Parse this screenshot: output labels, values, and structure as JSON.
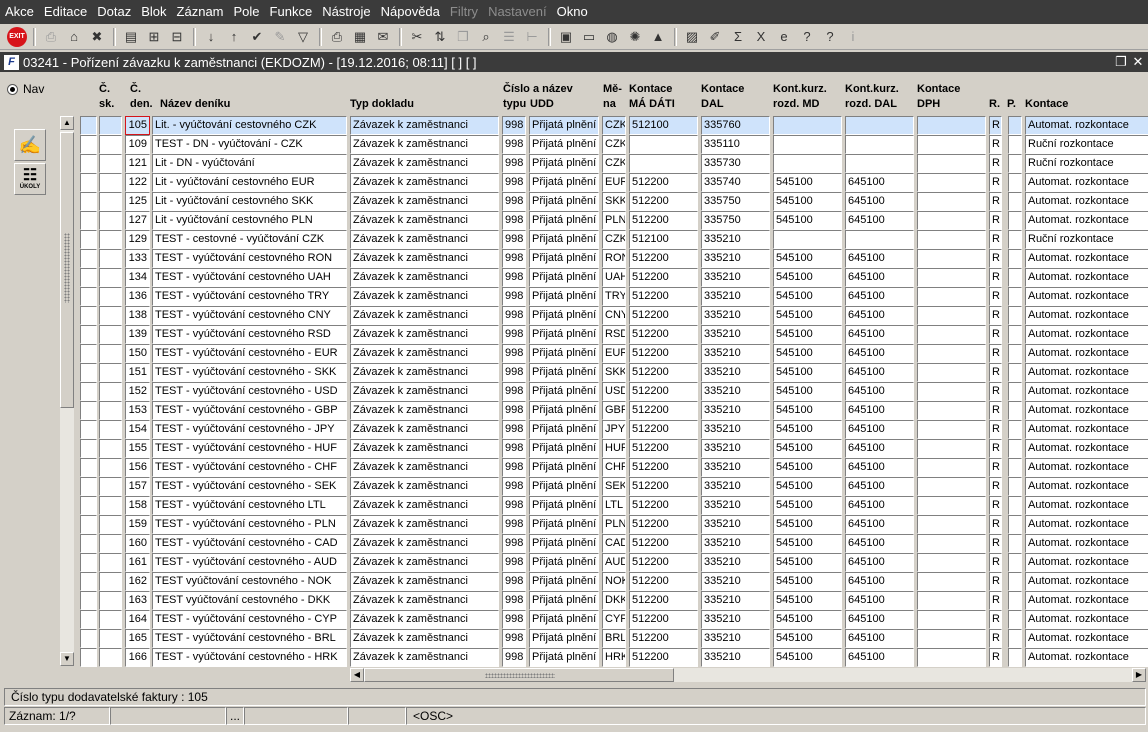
{
  "menu": [
    {
      "label": "Akce",
      "disabled": false
    },
    {
      "label": "Editace",
      "disabled": false
    },
    {
      "label": "Dotaz",
      "disabled": false
    },
    {
      "label": "Blok",
      "disabled": false
    },
    {
      "label": "Záznam",
      "disabled": false
    },
    {
      "label": "Pole",
      "disabled": false
    },
    {
      "label": "Funkce",
      "disabled": false
    },
    {
      "label": "Nástroje",
      "disabled": false
    },
    {
      "label": "Nápověda",
      "disabled": false
    },
    {
      "label": "Filtry",
      "disabled": true
    },
    {
      "label": "Nastavení",
      "disabled": true
    },
    {
      "label": "Okno",
      "disabled": false
    }
  ],
  "toolbar": {
    "exit_label": "EXIT",
    "groups": [
      [
        {
          "icon": "print-preview-icon",
          "glyph": "⎙",
          "disabled": true
        },
        {
          "icon": "home-icon",
          "glyph": "⌂",
          "disabled": false
        },
        {
          "icon": "delete-record-icon",
          "glyph": "✖",
          "disabled": false
        }
      ],
      [
        {
          "icon": "folder-icon",
          "glyph": "▤",
          "disabled": false
        },
        {
          "icon": "query-icon",
          "glyph": "⊞",
          "disabled": false
        },
        {
          "icon": "clear-icon",
          "glyph": "⊟",
          "disabled": false
        }
      ],
      [
        {
          "icon": "sort-asc-icon",
          "glyph": "↓",
          "disabled": false
        },
        {
          "icon": "sort-desc-icon",
          "glyph": "↑",
          "disabled": false
        },
        {
          "icon": "check-icon",
          "glyph": "✔",
          "disabled": false
        },
        {
          "icon": "wrench-icon",
          "glyph": "✎",
          "disabled": true
        },
        {
          "icon": "filter-icon",
          "glyph": "▽",
          "disabled": false
        }
      ],
      [
        {
          "icon": "printer-icon",
          "glyph": "⎙",
          "disabled": false
        },
        {
          "icon": "print-setup-icon",
          "glyph": "▦",
          "disabled": false
        },
        {
          "icon": "mail-icon",
          "glyph": "✉",
          "disabled": false
        }
      ],
      [
        {
          "icon": "cut-icon",
          "glyph": "✂",
          "disabled": false
        },
        {
          "icon": "paste-icon",
          "glyph": "⇅",
          "disabled": false
        },
        {
          "icon": "copy-icon",
          "glyph": "❐",
          "disabled": true
        },
        {
          "icon": "find-icon",
          "glyph": "⌕",
          "disabled": false
        },
        {
          "icon": "list-icon",
          "glyph": "☰",
          "disabled": true
        },
        {
          "icon": "tree-icon",
          "glyph": "⊢",
          "disabled": true
        }
      ],
      [
        {
          "icon": "calculator-icon",
          "glyph": "▣",
          "disabled": false
        },
        {
          "icon": "save-icon",
          "glyph": "▭",
          "disabled": false
        },
        {
          "icon": "globe-icon",
          "glyph": "◍",
          "disabled": false
        },
        {
          "icon": "sun-icon",
          "glyph": "✺",
          "disabled": false
        },
        {
          "icon": "mountain-icon",
          "glyph": "▲",
          "disabled": false
        }
      ],
      [
        {
          "icon": "chart-icon",
          "glyph": "▨",
          "disabled": false
        },
        {
          "icon": "edit-icon",
          "glyph": "✐",
          "disabled": false
        },
        {
          "icon": "sum-icon",
          "glyph": "Σ",
          "disabled": false
        },
        {
          "icon": "excel-icon",
          "glyph": "X",
          "disabled": false
        },
        {
          "icon": "web-icon",
          "glyph": "e",
          "disabled": false
        },
        {
          "icon": "help-context-icon",
          "glyph": "?",
          "disabled": false
        },
        {
          "icon": "help-icon",
          "glyph": "?",
          "disabled": false
        },
        {
          "icon": "info-icon",
          "glyph": "i",
          "disabled": true
        }
      ]
    ]
  },
  "window": {
    "title": "03241 - Pořízení závazku k zaměstnanci (EKDOZM) - [19.12.2016; 08:11]  [ ]  [ ]"
  },
  "nav": {
    "label": "Nav"
  },
  "side_buttons": {
    "edit_icon": "edit-document-icon",
    "ukoly_label": "ÚKOLY"
  },
  "columns": {
    "c_sk": {
      "l1": "Č.",
      "l2": "sk."
    },
    "c_den": {
      "l1": "Č.",
      "l2": "den."
    },
    "nazev": {
      "l1": "",
      "l2": "Název deníku"
    },
    "typ": {
      "l1": "",
      "l2": "Typ dokladu"
    },
    "cislo_typu": {
      "l1": "Číslo a název",
      "l2": "typu"
    },
    "udd": {
      "l1": "",
      "l2": "UDD"
    },
    "mena": {
      "l1": "Mě-",
      "l2": "na"
    },
    "md": {
      "l1": "Kontace",
      "l2": "MÁ DÁTI"
    },
    "dal": {
      "l1": "Kontace",
      "l2": "DAL"
    },
    "kurz_md": {
      "l1": "Kont.kurz.",
      "l2": "rozd. MD"
    },
    "kurz_dal": {
      "l1": "Kont.kurz.",
      "l2": "rozd. DAL"
    },
    "dph": {
      "l1": "Kontace",
      "l2": "DPH"
    },
    "r": {
      "l1": "",
      "l2": "R."
    },
    "p": {
      "l1": "",
      "l2": "P."
    },
    "kontace": {
      "l1": "",
      "l2": "Kontace"
    }
  },
  "rows": [
    {
      "cis": "105",
      "nazev": "Lit. - vyúčtování cestovného CZK",
      "typ": "Závazek k zaměstnanci",
      "tc": "998",
      "udd": "Přijatá plnění z",
      "mena": "CZK",
      "md": "512100",
      "dal": "335760",
      "kmd": "",
      "kdal": "",
      "dph": "",
      "r": "R",
      "p": "",
      "kontace": "Automat. rozkontace"
    },
    {
      "cis": "109",
      "nazev": "TEST - DN - vyúčtování - CZK",
      "typ": "Závazek k zaměstnanci",
      "tc": "998",
      "udd": "Přijatá plnění z",
      "mena": "CZK",
      "md": "",
      "dal": "335110",
      "kmd": "",
      "kdal": "",
      "dph": "",
      "r": "R",
      "p": "",
      "kontace": "Ruční rozkontace"
    },
    {
      "cis": "121",
      "nazev": "Lit - DN - vyúčtování",
      "typ": "Závazek k zaměstnanci",
      "tc": "998",
      "udd": "Přijatá plnění z",
      "mena": "CZK",
      "md": "",
      "dal": "335730",
      "kmd": "",
      "kdal": "",
      "dph": "",
      "r": "R",
      "p": "",
      "kontace": "Ruční rozkontace"
    },
    {
      "cis": "122",
      "nazev": "Lit - vyúčtování cestovného EUR",
      "typ": "Závazek k zaměstnanci",
      "tc": "998",
      "udd": "Přijatá plnění z",
      "mena": "EUR",
      "md": "512200",
      "dal": "335740",
      "kmd": "545100",
      "kdal": "645100",
      "dph": "",
      "r": "R",
      "p": "",
      "kontace": "Automat. rozkontace"
    },
    {
      "cis": "125",
      "nazev": "Lit - vyúčtování cestovného SKK",
      "typ": "Závazek k zaměstnanci",
      "tc": "998",
      "udd": "Přijatá plnění z",
      "mena": "SKK",
      "md": "512200",
      "dal": "335750",
      "kmd": "545100",
      "kdal": "645100",
      "dph": "",
      "r": "R",
      "p": "",
      "kontace": "Automat. rozkontace"
    },
    {
      "cis": "127",
      "nazev": "Lit - vyúčtování cestovného PLN",
      "typ": "Závazek k zaměstnanci",
      "tc": "998",
      "udd": "Přijatá plnění z",
      "mena": "PLN",
      "md": "512200",
      "dal": "335750",
      "kmd": "545100",
      "kdal": "645100",
      "dph": "",
      "r": "R",
      "p": "",
      "kontace": "Automat. rozkontace"
    },
    {
      "cis": "129",
      "nazev": "TEST - cestovné - vyúčtování CZK",
      "typ": "Závazek k zaměstnanci",
      "tc": "998",
      "udd": "Přijatá plnění z",
      "mena": "CZK",
      "md": "512100",
      "dal": "335210",
      "kmd": "",
      "kdal": "",
      "dph": "",
      "r": "R",
      "p": "",
      "kontace": "Ruční rozkontace"
    },
    {
      "cis": "133",
      "nazev": "TEST - vyúčtování cestovného RON",
      "typ": "Závazek k zaměstnanci",
      "tc": "998",
      "udd": "Přijatá plnění z",
      "mena": "RON",
      "md": "512200",
      "dal": "335210",
      "kmd": "545100",
      "kdal": "645100",
      "dph": "",
      "r": "R",
      "p": "",
      "kontace": "Automat. rozkontace"
    },
    {
      "cis": "134",
      "nazev": "TEST - vyúčtování cestovného UAH",
      "typ": "Závazek k zaměstnanci",
      "tc": "998",
      "udd": "Přijatá plnění z",
      "mena": "UAH",
      "md": "512200",
      "dal": "335210",
      "kmd": "545100",
      "kdal": "645100",
      "dph": "",
      "r": "R",
      "p": "",
      "kontace": "Automat. rozkontace"
    },
    {
      "cis": "136",
      "nazev": "TEST - vyúčtování cestovného TRY",
      "typ": "Závazek k zaměstnanci",
      "tc": "998",
      "udd": "Přijatá plnění z",
      "mena": "TRY",
      "md": "512200",
      "dal": "335210",
      "kmd": "545100",
      "kdal": "645100",
      "dph": "",
      "r": "R",
      "p": "",
      "kontace": "Automat. rozkontace"
    },
    {
      "cis": "138",
      "nazev": "TEST - vyúčtování cestovného CNY",
      "typ": "Závazek k zaměstnanci",
      "tc": "998",
      "udd": "Přijatá plnění z",
      "mena": "CNY",
      "md": "512200",
      "dal": "335210",
      "kmd": "545100",
      "kdal": "645100",
      "dph": "",
      "r": "R",
      "p": "",
      "kontace": "Automat. rozkontace"
    },
    {
      "cis": "139",
      "nazev": "TEST - vyúčtování cestovného RSD",
      "typ": "Závazek k zaměstnanci",
      "tc": "998",
      "udd": "Přijatá plnění z",
      "mena": "RSD",
      "md": "512200",
      "dal": "335210",
      "kmd": "545100",
      "kdal": "645100",
      "dph": "",
      "r": "R",
      "p": "",
      "kontace": "Automat. rozkontace"
    },
    {
      "cis": "150",
      "nazev": "TEST - vyúčtování cestovného - EUR",
      "typ": "Závazek k zaměstnanci",
      "tc": "998",
      "udd": "Přijatá plnění z",
      "mena": "EUR",
      "md": "512200",
      "dal": "335210",
      "kmd": "545100",
      "kdal": "645100",
      "dph": "",
      "r": "R",
      "p": "",
      "kontace": "Automat. rozkontace"
    },
    {
      "cis": "151",
      "nazev": "TEST - vyúčtování cestovného - SKK",
      "typ": "Závazek k zaměstnanci",
      "tc": "998",
      "udd": "Přijatá plnění z",
      "mena": "SKK",
      "md": "512200",
      "dal": "335210",
      "kmd": "545100",
      "kdal": "645100",
      "dph": "",
      "r": "R",
      "p": "",
      "kontace": "Automat. rozkontace"
    },
    {
      "cis": "152",
      "nazev": "TEST - vyúčtování cestovného - USD",
      "typ": "Závazek k zaměstnanci",
      "tc": "998",
      "udd": "Přijatá plnění z",
      "mena": "USD",
      "md": "512200",
      "dal": "335210",
      "kmd": "545100",
      "kdal": "645100",
      "dph": "",
      "r": "R",
      "p": "",
      "kontace": "Automat. rozkontace"
    },
    {
      "cis": "153",
      "nazev": "TEST - vyúčtování cestovného - GBP",
      "typ": "Závazek k zaměstnanci",
      "tc": "998",
      "udd": "Přijatá plnění z",
      "mena": "GBP",
      "md": "512200",
      "dal": "335210",
      "kmd": "545100",
      "kdal": "645100",
      "dph": "",
      "r": "R",
      "p": "",
      "kontace": "Automat. rozkontace"
    },
    {
      "cis": "154",
      "nazev": "TEST - vyúčtování cestovného - JPY",
      "typ": "Závazek k zaměstnanci",
      "tc": "998",
      "udd": "Přijatá plnění z",
      "mena": "JPY",
      "md": "512200",
      "dal": "335210",
      "kmd": "545100",
      "kdal": "645100",
      "dph": "",
      "r": "R",
      "p": "",
      "kontace": "Automat. rozkontace"
    },
    {
      "cis": "155",
      "nazev": "TEST - vyúčtování cestovného - HUF",
      "typ": "Závazek k zaměstnanci",
      "tc": "998",
      "udd": "Přijatá plnění z",
      "mena": "HUF",
      "md": "512200",
      "dal": "335210",
      "kmd": "545100",
      "kdal": "645100",
      "dph": "",
      "r": "R",
      "p": "",
      "kontace": "Automat. rozkontace"
    },
    {
      "cis": "156",
      "nazev": "TEST - vyúčtování cestovného - CHF",
      "typ": "Závazek k zaměstnanci",
      "tc": "998",
      "udd": "Přijatá plnění z",
      "mena": "CHF",
      "md": "512200",
      "dal": "335210",
      "kmd": "545100",
      "kdal": "645100",
      "dph": "",
      "r": "R",
      "p": "",
      "kontace": "Automat. rozkontace"
    },
    {
      "cis": "157",
      "nazev": "TEST - vyúčtování cestovného - SEK",
      "typ": "Závazek k zaměstnanci",
      "tc": "998",
      "udd": "Přijatá plnění z",
      "mena": "SEK",
      "md": "512200",
      "dal": "335210",
      "kmd": "545100",
      "kdal": "645100",
      "dph": "",
      "r": "R",
      "p": "",
      "kontace": "Automat. rozkontace"
    },
    {
      "cis": "158",
      "nazev": "TEST - vyúčtování cestovného LTL",
      "typ": "Závazek k zaměstnanci",
      "tc": "998",
      "udd": "Přijatá plnění z",
      "mena": "LTL",
      "md": "512200",
      "dal": "335210",
      "kmd": "545100",
      "kdal": "645100",
      "dph": "",
      "r": "R",
      "p": "",
      "kontace": "Automat. rozkontace"
    },
    {
      "cis": "159",
      "nazev": "TEST - vyúčtování cestovného - PLN",
      "typ": "Závazek k zaměstnanci",
      "tc": "998",
      "udd": "Přijatá plnění z",
      "mena": "PLN",
      "md": "512200",
      "dal": "335210",
      "kmd": "545100",
      "kdal": "645100",
      "dph": "",
      "r": "R",
      "p": "",
      "kontace": "Automat. rozkontace"
    },
    {
      "cis": "160",
      "nazev": "TEST - vyúčtování cestovného - CAD",
      "typ": "Závazek k zaměstnanci",
      "tc": "998",
      "udd": "Přijatá plnění z",
      "mena": "CAD",
      "md": "512200",
      "dal": "335210",
      "kmd": "545100",
      "kdal": "645100",
      "dph": "",
      "r": "R",
      "p": "",
      "kontace": "Automat. rozkontace"
    },
    {
      "cis": "161",
      "nazev": "TEST - vyúčtování cestovného - AUD",
      "typ": "Závazek k zaměstnanci",
      "tc": "998",
      "udd": "Přijatá plnění z",
      "mena": "AUD",
      "md": "512200",
      "dal": "335210",
      "kmd": "545100",
      "kdal": "645100",
      "dph": "",
      "r": "R",
      "p": "",
      "kontace": "Automat. rozkontace"
    },
    {
      "cis": "162",
      "nazev": "TEST vyúčtování cestovného - NOK",
      "typ": "Závazek k zaměstnanci",
      "tc": "998",
      "udd": "Přijatá plnění z",
      "mena": "NOK",
      "md": "512200",
      "dal": "335210",
      "kmd": "545100",
      "kdal": "645100",
      "dph": "",
      "r": "R",
      "p": "",
      "kontace": "Automat. rozkontace"
    },
    {
      "cis": "163",
      "nazev": "TEST vyúčtování cestovného - DKK",
      "typ": "Závazek k zaměstnanci",
      "tc": "998",
      "udd": "Přijatá plnění z",
      "mena": "DKK",
      "md": "512200",
      "dal": "335210",
      "kmd": "545100",
      "kdal": "645100",
      "dph": "",
      "r": "R",
      "p": "",
      "kontace": "Automat. rozkontace"
    },
    {
      "cis": "164",
      "nazev": "TEST - vyúčtování cestovného - CYP",
      "typ": "Závazek k zaměstnanci",
      "tc": "998",
      "udd": "Přijatá plnění z",
      "mena": "CYP",
      "md": "512200",
      "dal": "335210",
      "kmd": "545100",
      "kdal": "645100",
      "dph": "",
      "r": "R",
      "p": "",
      "kontace": "Automat. rozkontace"
    },
    {
      "cis": "165",
      "nazev": "TEST - vyúčtování cestovného - BRL",
      "typ": "Závazek k zaměstnanci",
      "tc": "998",
      "udd": "Přijatá plnění z",
      "mena": "BRL",
      "md": "512200",
      "dal": "335210",
      "kmd": "545100",
      "kdal": "645100",
      "dph": "",
      "r": "R",
      "p": "",
      "kontace": "Automat. rozkontace"
    },
    {
      "cis": "166",
      "nazev": "TEST - vyúčtování cestovného - HRK",
      "typ": "Závazek k zaměstnanci",
      "tc": "998",
      "udd": "Přijatá plnění z",
      "mena": "HRK",
      "md": "512200",
      "dal": "335210",
      "kmd": "545100",
      "kdal": "645100",
      "dph": "",
      "r": "R",
      "p": "",
      "kontace": "Automat. rozkontace"
    }
  ],
  "selected_row": 0,
  "hint": "Číslo typu dodavatelské faktury : 105",
  "status": {
    "record": "Záznam: 1/?",
    "s2": "",
    "s3": "...",
    "s4": "",
    "s5": "",
    "osc": "<OSC>"
  }
}
